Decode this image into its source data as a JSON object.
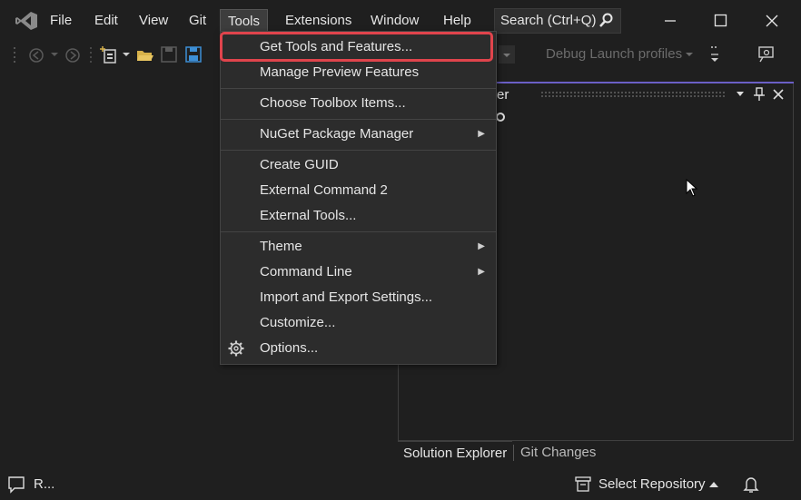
{
  "menubar": {
    "items": [
      "File",
      "Edit",
      "View",
      "Git",
      "Tools",
      "Extensions",
      "Window",
      "Help"
    ],
    "search_label": "Search (Ctrl+Q)"
  },
  "toolbar": {
    "debug_profiles": "Debug Launch profiles"
  },
  "tools_menu": {
    "items": [
      {
        "label": "Get Tools and Features..."
      },
      {
        "label": "Manage Preview Features"
      },
      {
        "label": "Choose Toolbox Items..."
      },
      {
        "label": "NuGet Package Manager"
      },
      {
        "label": "Create GUID"
      },
      {
        "label": "External Command 2"
      },
      {
        "label": "External Tools..."
      },
      {
        "label": "Theme"
      },
      {
        "label": "Command Line"
      },
      {
        "label": "Import and Export Settings..."
      },
      {
        "label": "Customize..."
      },
      {
        "label": "Options..."
      }
    ]
  },
  "panel": {
    "title_fragment": "er",
    "tabs": [
      "Solution Explorer",
      "Git Changes"
    ]
  },
  "statusbar": {
    "left_text": "R...",
    "select_repository": "Select Repository"
  },
  "colors": {
    "highlight_border": "#e0444c",
    "panel_accent": "#6b5fc6",
    "save_blue": "#3d8fd6",
    "folder_yellow": "#d7b14a"
  }
}
